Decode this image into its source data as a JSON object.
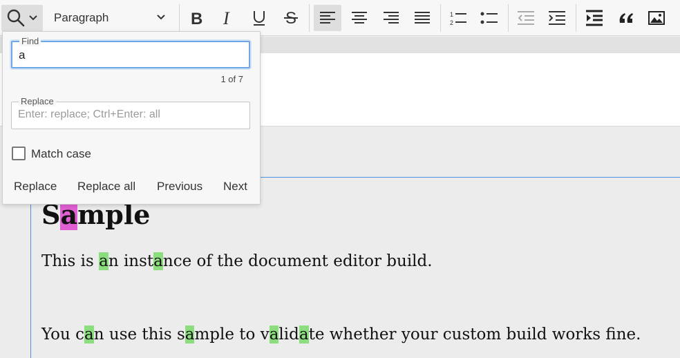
{
  "toolbar": {
    "heading_select": "Paragraph",
    "buttons": [
      "find-and-replace",
      "bold",
      "italic",
      "underline",
      "strikethrough",
      "align-left",
      "align-center",
      "align-right",
      "justify",
      "numbered-list",
      "bulleted-list",
      "outdent",
      "indent",
      "block-indent",
      "block-quote",
      "insert-image"
    ]
  },
  "find_panel": {
    "find_label": "Find",
    "find_value": "a",
    "match_counter": "1 of 7",
    "replace_label": "Replace",
    "replace_placeholder": "Enter: replace; Ctrl+Enter: all",
    "match_case_label": "Match case",
    "match_case_checked": false,
    "replace_button": "Replace",
    "replace_all_button": "Replace all",
    "previous_button": "Previous",
    "next_button": "Next"
  },
  "document": {
    "heading": [
      "S",
      "a",
      "mple"
    ],
    "paragraph1": [
      "This is ",
      "a",
      "n inst",
      "a",
      "nce of the document editor build."
    ],
    "paragraph2": [
      "You c",
      "a",
      "n use this s",
      "a",
      "mple to v",
      "a",
      "lid",
      "a",
      "te whether your custom build works fine."
    ]
  },
  "colors": {
    "match_highlight": "#8bdd7e",
    "current_match_highlight": "#e05fd3",
    "focus_blue": "#6fa6e6"
  }
}
